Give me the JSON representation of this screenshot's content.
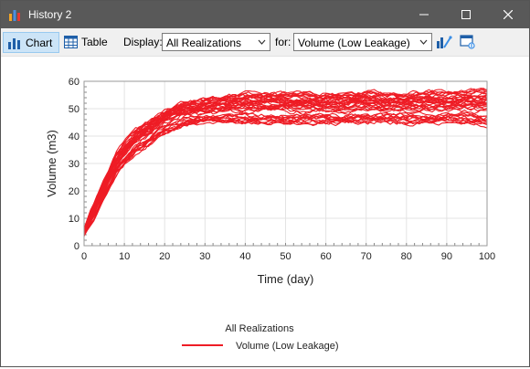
{
  "window": {
    "title": "History 2"
  },
  "toolbar": {
    "chart_label": "Chart",
    "table_label": "Table",
    "display_label": "Display:",
    "display_value": "All Realizations",
    "for_label": "for:",
    "for_value": "Volume (Low Leakage)"
  },
  "colors": {
    "series": "#ee1c25",
    "titlebar": "#595959",
    "active_tab": "#cce4f7"
  },
  "chart_data": {
    "type": "line",
    "xlabel": "Time (day)",
    "ylabel": "Volume (m3)",
    "xlim": [
      0,
      100
    ],
    "ylim": [
      0,
      60
    ],
    "x_ticks": [
      0,
      10,
      20,
      30,
      40,
      50,
      60,
      70,
      80,
      90,
      100
    ],
    "y_ticks": [
      0,
      10,
      20,
      30,
      40,
      50,
      60
    ],
    "grid": true,
    "legend_title": "All Realizations",
    "legend_position": "bottom-center",
    "series": [
      {
        "name": "Volume (Low Leakage)",
        "color": "#ee1c25",
        "realizations": "many",
        "x": [
          0,
          2,
          5,
          8,
          10,
          13,
          15,
          18,
          20,
          25,
          30,
          35,
          40,
          45,
          50,
          55,
          60,
          65,
          70,
          75,
          80,
          85,
          90,
          95,
          100
        ],
        "band_low": [
          4,
          9,
          18,
          26,
          30,
          34,
          36,
          39,
          41,
          44,
          45,
          45,
          45,
          45,
          45,
          45,
          45,
          45,
          45,
          45,
          45,
          45,
          45,
          45,
          44
        ],
        "band_mean": [
          5,
          11,
          21,
          30,
          34,
          39,
          41,
          44,
          46,
          48,
          49,
          50,
          50,
          50,
          50,
          51,
          51,
          51,
          51,
          51,
          51,
          51,
          51,
          51,
          51
        ],
        "band_high": [
          6,
          14,
          24,
          34,
          38,
          43,
          45,
          48,
          50,
          53,
          54,
          55,
          56,
          56,
          56,
          56,
          56,
          56,
          57,
          56,
          56,
          57,
          57,
          57,
          58
        ]
      }
    ]
  }
}
